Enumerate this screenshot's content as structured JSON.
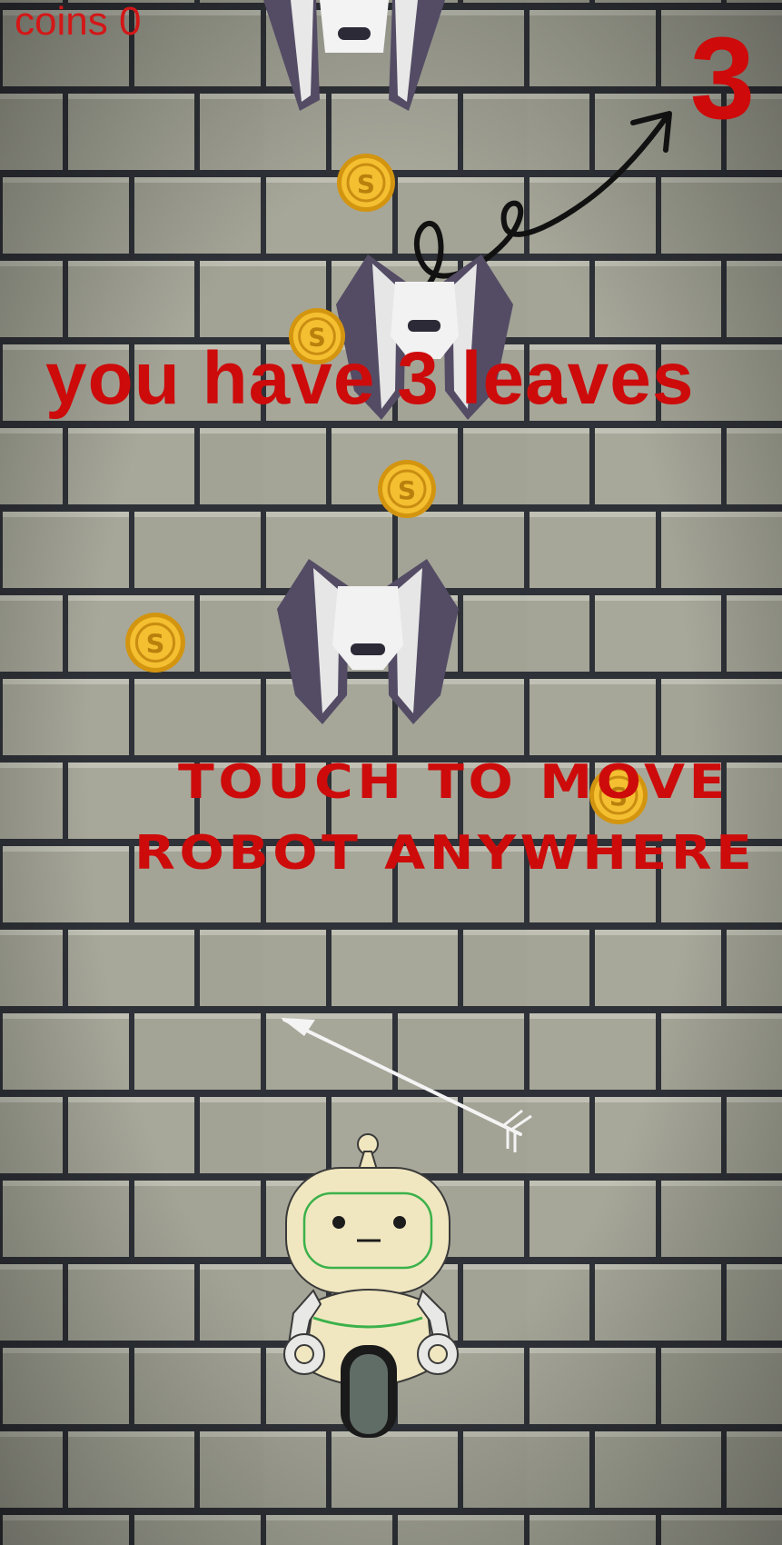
{
  "hud": {
    "coins_label": "coins 0",
    "lives": "3"
  },
  "messages": {
    "leaves": "you have 3 leaves",
    "touch_line_1": "TOUCH TO MOVE",
    "touch_line_2": "ROBOT ANYWHERE"
  },
  "colors": {
    "text_red": "#cd0b0b",
    "wall_brick": "#a4a597",
    "wall_mortar": "#2f3238",
    "coin_gold": "#f2b51c",
    "robot_body": "#f0e7c0",
    "enemy_purple": "#5e566f"
  },
  "sprites": {
    "enemies": [
      "enemy-ship",
      "enemy-ship",
      "enemy-ship"
    ],
    "coins": [
      "coin-icon",
      "coin-icon",
      "coin-icon",
      "coin-icon",
      "coin-icon"
    ],
    "hint_arrows": [
      "curly-arrow-icon",
      "arrow-icon"
    ],
    "player": "robot-player"
  }
}
